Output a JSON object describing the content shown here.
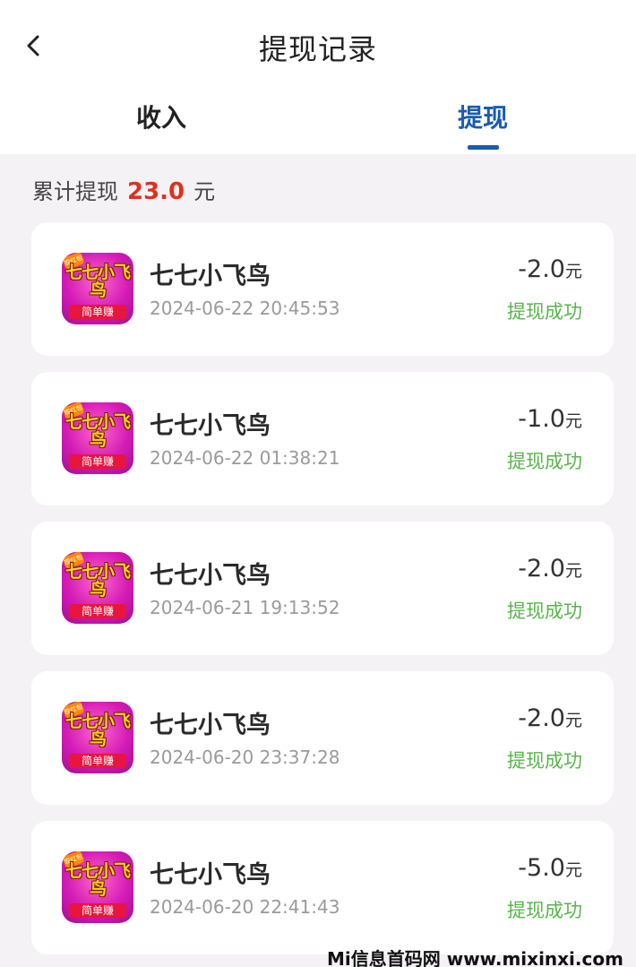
{
  "header": {
    "title": "提现记录",
    "back_icon": "chevron-left-icon"
  },
  "tabs": [
    {
      "label": "收入",
      "active": false
    },
    {
      "label": "提现",
      "active": true
    }
  ],
  "colors": {
    "accent": "#1a5cb0",
    "amount_red": "#e0301e",
    "success_green": "#58b54a"
  },
  "summary": {
    "prefix": "累计提现",
    "amount": "23.0",
    "unit": "元"
  },
  "records": [
    {
      "name": "七七小飞鸟",
      "time": "2024-06-22 20:45:53",
      "amount": "-2.0",
      "unit": "元",
      "status": "提现成功"
    },
    {
      "name": "七七小飞鸟",
      "time": "2024-06-22 01:38:21",
      "amount": "-1.0",
      "unit": "元",
      "status": "提现成功"
    },
    {
      "name": "七七小飞鸟",
      "time": "2024-06-21 19:13:52",
      "amount": "-2.0",
      "unit": "元",
      "status": "提现成功"
    },
    {
      "name": "七七小飞鸟",
      "time": "2024-06-20 23:37:28",
      "amount": "-2.0",
      "unit": "元",
      "status": "提现成功"
    },
    {
      "name": "七七小飞鸟",
      "time": "2024-06-20 22:41:43",
      "amount": "-5.0",
      "unit": "元",
      "status": "提现成功"
    }
  ],
  "app_logo": {
    "badge": "现红包",
    "word": "七七小飞鸟",
    "strip": "简单赚"
  },
  "watermark": "Mi信息首码网 www.mixinxi.com"
}
